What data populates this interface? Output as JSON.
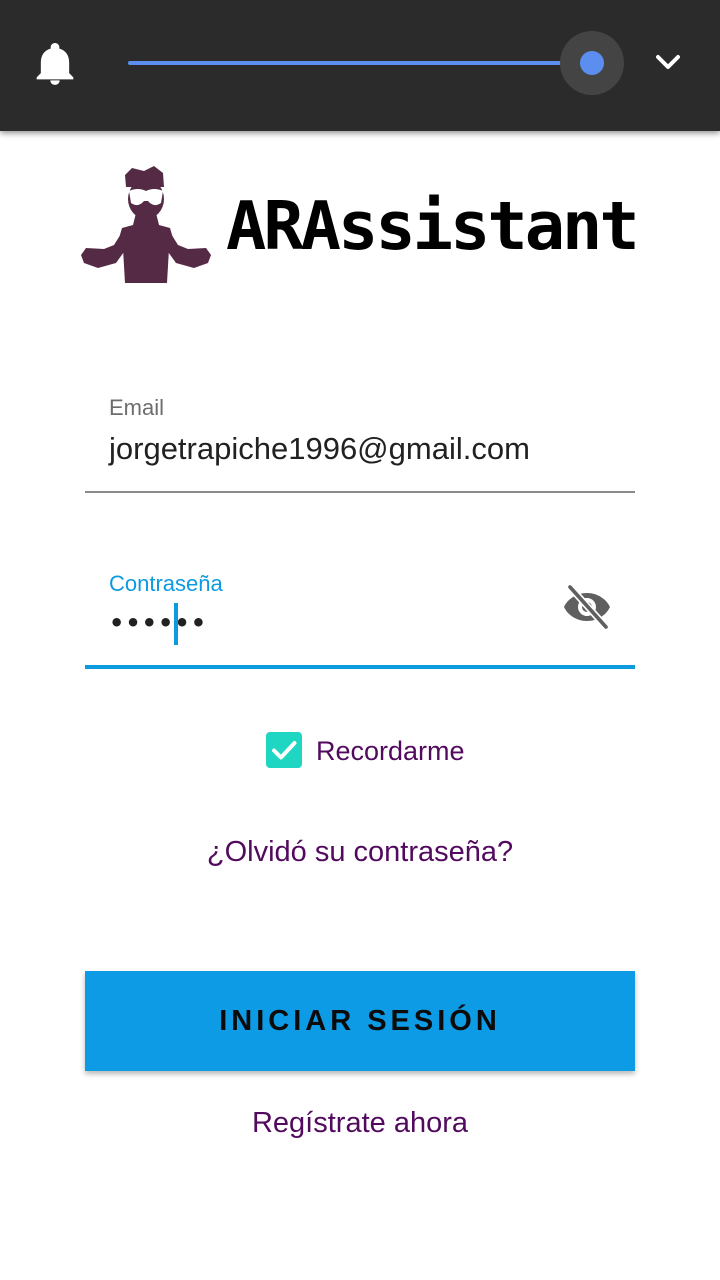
{
  "status_shade": {
    "icons": {
      "notification": "bell-icon",
      "expand": "chevron-down-icon"
    },
    "brightness_level": 1.0,
    "colors": {
      "background": "#2b2b2b",
      "slider": "#5b8eef"
    }
  },
  "logo": {
    "mascot_icon": "mascot-figure-icon",
    "brand_name": "ARAssistant"
  },
  "email": {
    "label": "Email",
    "value": "jorgetrapiche1996@gmail.com"
  },
  "password": {
    "label": "Contraseña",
    "value": "••••••",
    "toggle_icon": "eye-off-icon"
  },
  "remember": {
    "label": "Recordarme",
    "checked": true
  },
  "links": {
    "forgot": "¿Olvidó su contraseña?",
    "register": "Regístrate ahora"
  },
  "actions": {
    "login_label": "INICIAR SESIÓN"
  },
  "colors": {
    "accent": "#0d9be5",
    "checkbox": "#1fd6c3",
    "link": "#520a5e",
    "mascot": "#552a45"
  }
}
